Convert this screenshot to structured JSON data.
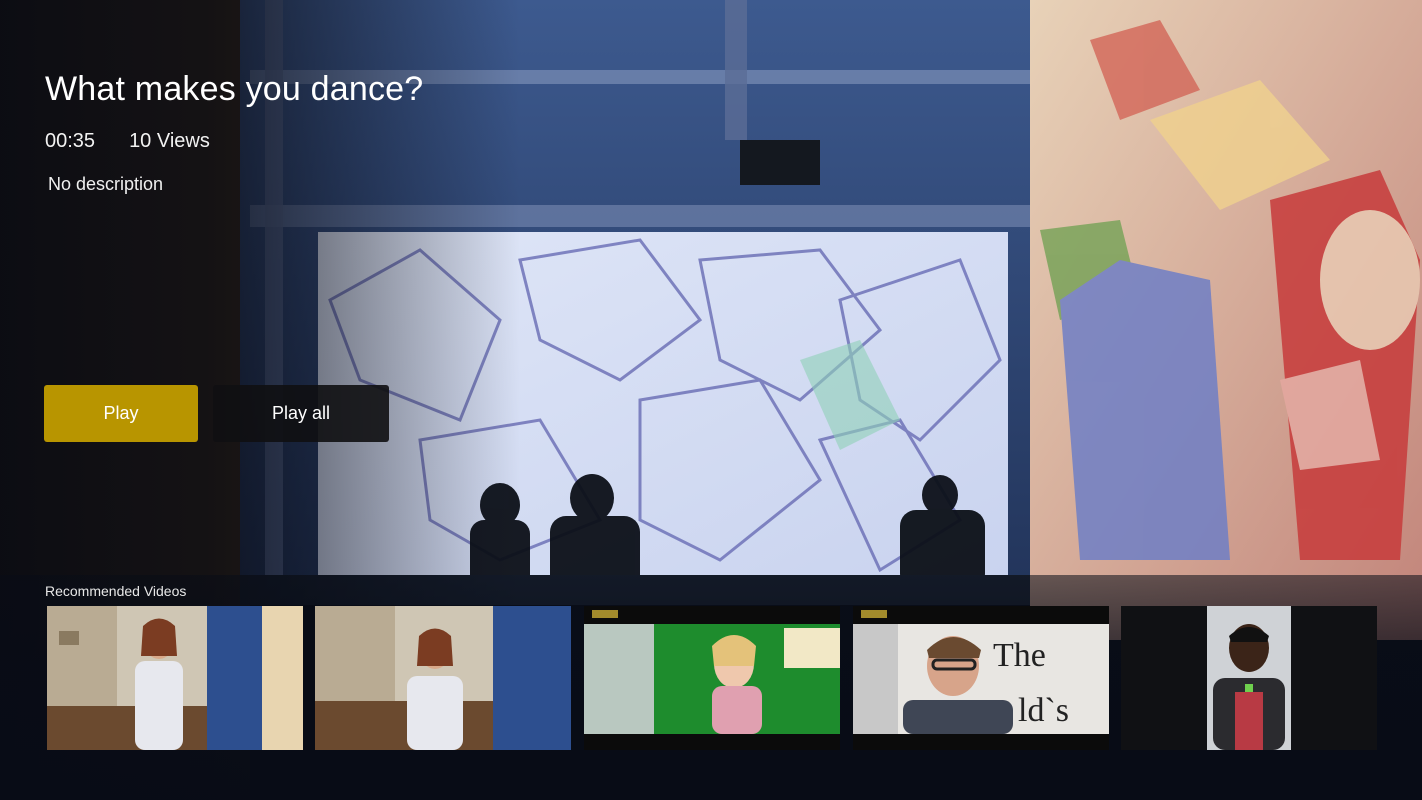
{
  "video": {
    "title": "What makes you dance?",
    "duration": "00:35",
    "views": "10 Views",
    "description": "No description"
  },
  "actions": {
    "play_label": "Play",
    "play_all_label": "Play all"
  },
  "recommended": {
    "heading": "Recommended Videos",
    "items": [
      {
        "name": "recommended-video-1"
      },
      {
        "name": "recommended-video-2"
      },
      {
        "name": "recommended-video-3"
      },
      {
        "name": "recommended-video-4"
      },
      {
        "name": "recommended-video-5"
      }
    ]
  },
  "colors": {
    "accent": "#b89500",
    "secondary_button": "#0f0f12"
  }
}
